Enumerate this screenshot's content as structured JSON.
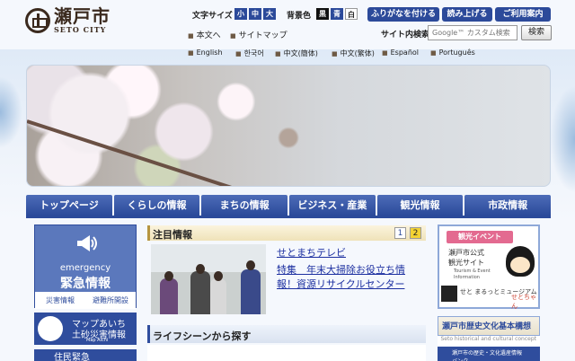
{
  "header": {
    "logo_title": "瀬戸市",
    "logo_subtitle": "SETO CITY",
    "font_size_label": "文字サイズ",
    "font_sizes": [
      "小",
      "中",
      "大"
    ],
    "bg_color_label": "背景色",
    "bg_colors": [
      "黒",
      "青",
      "白"
    ],
    "buttons": [
      "ふりがなを付ける",
      "読み上げる",
      "ご利用案内"
    ],
    "links": [
      "本文へ",
      "サイトマップ"
    ],
    "search_label": "サイト内検索",
    "search_placeholder": "Google™ カスタム検索",
    "search_button": "検索",
    "languages": [
      "English",
      "한국어",
      "中文(簡体)",
      "中文(繁体)",
      "Español",
      "Português"
    ]
  },
  "nav": [
    "トップページ",
    "くらしの情報",
    "まちの情報",
    "ビジネス・産業",
    "観光情報",
    "市政情報"
  ],
  "emergency": {
    "en": "emergency",
    "jp": "緊急情報",
    "links": [
      "災害情報",
      "避難所開設"
    ]
  },
  "map_aichi": {
    "line1": "マップあいち",
    "line2": "土砂災害情報",
    "line3": "Map Aichi"
  },
  "left_more": "住民緊急",
  "featured": {
    "title": "注目情報",
    "pages": [
      "1",
      "2"
    ],
    "label": "せとまちテレビ",
    "text": "特集　年末大掃除お役立ち情報！資源リサイクルセンター"
  },
  "life": {
    "title": "ライフシーンから探す"
  },
  "tourism": {
    "ribbon": "観光イベント",
    "line1": "瀬戸市公式",
    "line2": "観光サイト",
    "line3": "Tourism & Event",
    "line4": "Information",
    "museum": "せと まるっとミュージアム",
    "mascot": "せとちゃん"
  },
  "bunka": {
    "title": "瀬戸市歴史文化基本構想",
    "sub": "Seto historical and cultural concept"
  },
  "right_more": "瀬戸市の歴史・文化遺産情報バンク",
  "colors": {
    "nav_blue": "#2b4a9a",
    "accent_gold": "#b69540",
    "link_blue": "#1c2fa0",
    "pink": "#e36a90"
  }
}
